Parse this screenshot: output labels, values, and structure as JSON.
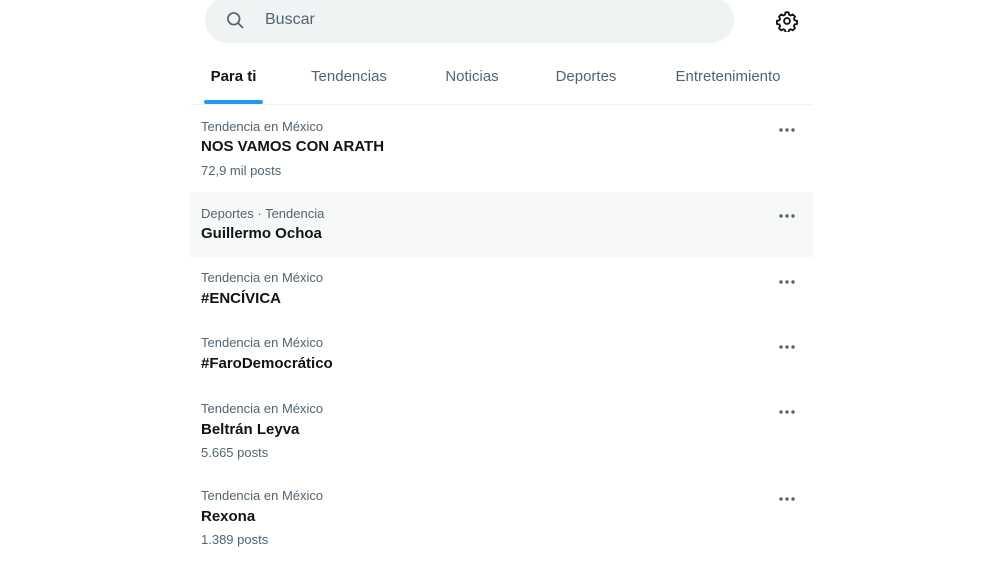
{
  "search": {
    "placeholder": "Buscar"
  },
  "tabs": [
    {
      "label": "Para ti",
      "active": true
    },
    {
      "label": "Tendencias",
      "active": false
    },
    {
      "label": "Noticias",
      "active": false
    },
    {
      "label": "Deportes",
      "active": false
    },
    {
      "label": "Entretenimiento",
      "active": false
    }
  ],
  "trends": [
    {
      "meta": "Tendencia en México",
      "name": "NOS VAMOS CON ARATH",
      "count": "72,9 mil posts"
    },
    {
      "meta": "Deportes · Tendencia",
      "name": "Guillermo Ochoa",
      "count": ""
    },
    {
      "meta": "Tendencia en México",
      "name": "#ENCÍVICA",
      "count": ""
    },
    {
      "meta": "Tendencia en México",
      "name": "#FaroDemocrático",
      "count": ""
    },
    {
      "meta": "Tendencia en México",
      "name": "Beltrán Leyva",
      "count": "5.665 posts"
    },
    {
      "meta": "Tendencia en México",
      "name": "Rexona",
      "count": "1.389 posts"
    }
  ],
  "colors": {
    "accent": "#1d9bf0",
    "text_primary": "#0f1419",
    "text_secondary": "#536471",
    "search_bg": "#eff3f4",
    "hover_bg": "#f7f9f9"
  },
  "icons": {
    "search": "search-icon",
    "settings": "gear-icon",
    "more": "more-horizontal-icon"
  }
}
